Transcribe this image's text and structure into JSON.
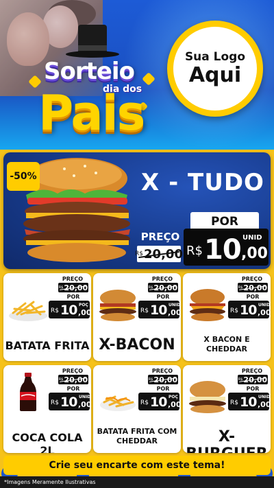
{
  "header": {
    "title_line1": "Sorteio",
    "title_line2": "dia dos",
    "title_line3": "Pais",
    "logo_line1": "Sua Logo",
    "logo_line2": "Aqui"
  },
  "hero": {
    "discount": "-50%",
    "name": "X - TUDO",
    "preco_label": "PREÇO",
    "old_currency": "R$",
    "old_value": "20,00",
    "por_label": "POR",
    "currency": "R$",
    "price_int": "10",
    "price_cents": ",00",
    "unit": "UNID"
  },
  "products": [
    {
      "name": "BATATA FRITA",
      "preco_label": "PREÇO",
      "old_currency": "R$",
      "old_value": "20,00",
      "por_label": "POR",
      "currency": "R$",
      "price_int": "10",
      "price_cents": ",00",
      "unit": "POÇ"
    },
    {
      "name": "X-BACON",
      "preco_label": "PREÇO",
      "old_currency": "R$",
      "old_value": "20,00",
      "por_label": "POR",
      "currency": "R$",
      "price_int": "10",
      "price_cents": ",00",
      "unit": "UNID"
    },
    {
      "name": "X BACON E CHEDDAR",
      "preco_label": "PREÇO",
      "old_currency": "R$",
      "old_value": "20,00",
      "por_label": "POR",
      "currency": "R$",
      "price_int": "10",
      "price_cents": ",00",
      "unit": "UNID"
    },
    {
      "name": "COCA COLA 2L",
      "preco_label": "PREÇO",
      "old_currency": "R$",
      "old_value": "20,00",
      "por_label": "POR",
      "currency": "R$",
      "price_int": "10",
      "price_cents": ",00",
      "unit": "UNID"
    },
    {
      "name": "BATATA FRITA COM CHEDDAR",
      "preco_label": "PREÇO",
      "old_currency": "R$",
      "old_value": "20,00",
      "por_label": "POR",
      "currency": "R$",
      "price_int": "10",
      "price_cents": ",00",
      "unit": "POÇ"
    },
    {
      "name": "X-BURGUER",
      "preco_label": "PREÇO",
      "old_currency": "R$",
      "old_value": "20,00",
      "por_label": "POR",
      "currency": "R$",
      "price_int": "10",
      "price_cents": ",00",
      "unit": "UNID"
    }
  ],
  "footer": {
    "cta": "Crie seu encarte com este tema!",
    "disclaimer": "*Imagens Meramente Ilustrativas"
  },
  "colors": {
    "brand_blue": "#1d5bd6",
    "brand_yellow": "#ffcc00",
    "hero_navy": "#173a8a"
  }
}
